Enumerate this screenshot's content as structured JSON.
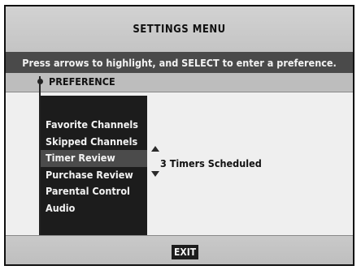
{
  "header": {
    "title": "SETTINGS MENU"
  },
  "instruction": "Press arrows to highlight, and SELECT to enter a preference.",
  "section": {
    "title": "PREFERENCE"
  },
  "menu": {
    "items": [
      {
        "label": "Favorite Channels",
        "selected": false
      },
      {
        "label": "Skipped Channels",
        "selected": false
      },
      {
        "label": "Timer Review",
        "selected": true
      },
      {
        "label": "Purchase Review",
        "selected": false
      },
      {
        "label": "Parental Control",
        "selected": false
      },
      {
        "label": "Audio",
        "selected": false
      }
    ]
  },
  "selected_value": "3 Timers Scheduled",
  "footer": {
    "exit_label": "EXIT"
  },
  "icons": {
    "up": "arrow-up-icon",
    "down": "arrow-down-icon",
    "marker": "bullet-icon"
  },
  "colors": {
    "panel": "#1c1c1c",
    "highlight": "#4b4b4b",
    "instruction_bg": "#4a4a4a"
  }
}
